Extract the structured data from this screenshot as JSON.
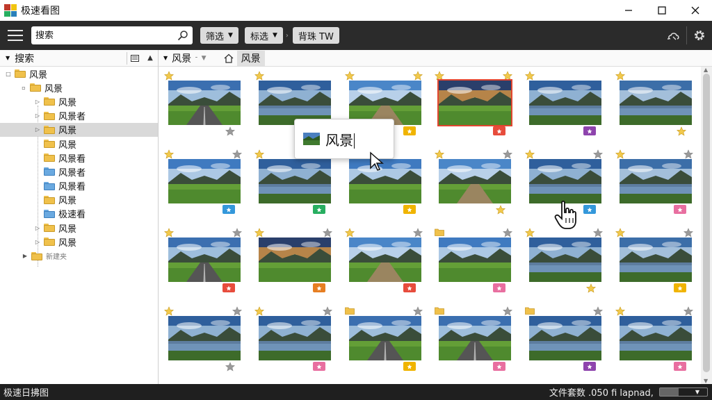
{
  "app": {
    "title": "极速看图",
    "logo_colors": [
      "#c0392b",
      "#f1c40f",
      "#27ae60",
      "#2980b9"
    ]
  },
  "window_controls": [
    "minimize-icon",
    "maximize-icon",
    "close-icon"
  ],
  "toolbar": {
    "search_placeholder": "搜索",
    "filter1_label": "筛选",
    "filter2_label": "标选",
    "extra_label": "背珠 TW",
    "icons": [
      "menu-icon",
      "search-icon",
      "cloud-icon",
      "gear-icon"
    ]
  },
  "left_panel": {
    "title": "搜索",
    "tree": [
      {
        "label": "风景",
        "depth": 0,
        "expander": "□",
        "color": "#f0c14b",
        "selected": false
      },
      {
        "label": "风景",
        "depth": 1,
        "expander": "▫",
        "color": "#f0c14b",
        "selected": false
      },
      {
        "label": "风景",
        "depth": 2,
        "expander": "▷",
        "color": "#f0c14b",
        "selected": false
      },
      {
        "label": "风景者",
        "depth": 2,
        "expander": "▷",
        "color": "#f0c14b",
        "selected": false
      },
      {
        "label": "风景",
        "depth": 2,
        "expander": "▷",
        "color": "#f0c14b",
        "selected": true
      },
      {
        "label": "风景",
        "depth": 2,
        "expander": "",
        "color": "#f0c14b",
        "selected": false
      },
      {
        "label": "风景看",
        "depth": 2,
        "expander": "",
        "color": "#f0c14b",
        "selected": false
      },
      {
        "label": "风景者",
        "depth": 2,
        "expander": "",
        "color": "#6aa9e0",
        "selected": false
      },
      {
        "label": "风景看",
        "depth": 2,
        "expander": "",
        "color": "#6aa9e0",
        "selected": false
      },
      {
        "label": "风景",
        "depth": 2,
        "expander": "",
        "color": "#f0c14b",
        "selected": false
      },
      {
        "label": "极速看",
        "depth": 2,
        "expander": "",
        "color": "#6aa9e0",
        "selected": false
      },
      {
        "label": "风景",
        "depth": 2,
        "expander": "▷",
        "color": "#f0c14b",
        "selected": false
      },
      {
        "label": "风景",
        "depth": 2,
        "expander": "▷",
        "color": "#f0c14b",
        "selected": false
      },
      {
        "label": "新建夹",
        "depth": 1,
        "expander": "▶",
        "color": "#f0c14b",
        "selected": false,
        "small": true
      }
    ]
  },
  "breadcrumb": {
    "root": "风景",
    "current": "风景"
  },
  "thumbnails": [
    {
      "tl": "star",
      "tr": "",
      "br": "star-gray",
      "scene": "road",
      "selected": false
    },
    {
      "tl": "star",
      "tr": "",
      "br": "",
      "scene": "lake",
      "selected": false
    },
    {
      "tl": "star",
      "tr": "star",
      "br": "badge",
      "badge_color": "#f0b400",
      "scene": "path",
      "selected": false
    },
    {
      "tl": "star",
      "tr": "star",
      "br": "badge",
      "badge_color": "#e74c3c",
      "scene": "sunset",
      "selected": true
    },
    {
      "tl": "star",
      "tr": "",
      "br": "badge",
      "badge_color": "#8e44ad",
      "scene": "lake",
      "selected": false
    },
    {
      "tl": "star",
      "tr": "",
      "br": "star",
      "scene": "valley",
      "selected": false
    },
    {
      "tl": "star",
      "tr": "star-gray",
      "br": "badge",
      "badge_color": "#3498db",
      "scene": "field",
      "selected": false
    },
    {
      "tl": "star",
      "tr": "star-gray",
      "br": "badge",
      "badge_color": "#27ae60",
      "scene": "lake",
      "selected": false
    },
    {
      "tl": "",
      "tr": "",
      "br": "badge",
      "badge_color": "#f0b400",
      "scene": "field",
      "selected": false
    },
    {
      "tl": "star",
      "tr": "star-gray",
      "br": "star",
      "scene": "path",
      "selected": false
    },
    {
      "tl": "star",
      "tr": "star-gray",
      "br": "badge",
      "badge_color": "#3498db",
      "scene": "lake",
      "selected": false
    },
    {
      "tl": "star",
      "tr": "star-gray",
      "br": "badge",
      "badge_color": "#e86fa0",
      "scene": "valley",
      "selected": false
    },
    {
      "tl": "star",
      "tr": "star-gray",
      "br": "badge",
      "badge_color": "#e74c3c",
      "scene": "road",
      "selected": false
    },
    {
      "tl": "star",
      "tr": "star-gray",
      "br": "badge",
      "badge_color": "#e67e22",
      "scene": "sunset",
      "selected": false
    },
    {
      "tl": "star",
      "tr": "star-gray",
      "br": "badge",
      "badge_color": "#e74c3c",
      "scene": "path",
      "selected": false
    },
    {
      "tl": "folder",
      "tr": "star-gray",
      "br": "badge",
      "badge_color": "#e86fa0",
      "scene": "field",
      "selected": false
    },
    {
      "tl": "star",
      "tr": "star-gray",
      "br": "star",
      "scene": "lake",
      "selected": false
    },
    {
      "tl": "star",
      "tr": "star-gray",
      "br": "badge",
      "badge_color": "#f0b400",
      "scene": "valley",
      "selected": false
    },
    {
      "tl": "star",
      "tr": "star-gray",
      "br": "star-gray",
      "scene": "lake",
      "selected": false
    },
    {
      "tl": "star",
      "tr": "star-gray",
      "br": "badge",
      "badge_color": "#e86fa0",
      "scene": "lake",
      "selected": false
    },
    {
      "tl": "folder",
      "tr": "star-gray",
      "br": "badge",
      "badge_color": "#f0b400",
      "scene": "road",
      "selected": false
    },
    {
      "tl": "folder",
      "tr": "star-gray",
      "br": "badge",
      "badge_color": "#e86fa0",
      "scene": "road",
      "selected": false
    },
    {
      "tl": "folder",
      "tr": "star-gray",
      "br": "badge",
      "badge_color": "#8e44ad",
      "scene": "lake",
      "selected": false
    },
    {
      "tl": "star",
      "tr": "star-gray",
      "br": "badge",
      "badge_color": "#e86fa0",
      "scene": "lake",
      "selected": false
    }
  ],
  "tooltip": {
    "text": "风景"
  },
  "status": {
    "left": "极速日拂图",
    "right": "文件套数 .050 fi lapnad,",
    "progress": 0.4
  }
}
